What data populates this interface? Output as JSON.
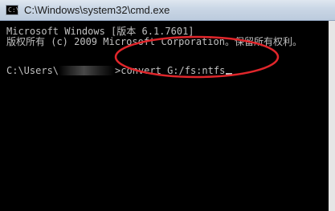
{
  "window": {
    "title": "C:\\Windows\\system32\\cmd.exe",
    "icon": "console-icon",
    "icon_glyph": "C:\\"
  },
  "console": {
    "line1": "Microsoft Windows [版本 6.1.7601]",
    "line2": "版权所有 (c) 2009 Microsoft Corporation。保留所有权利。",
    "prompt_prefix": "C:\\Users\\",
    "prompt_suffix": ">",
    "command": "convert G:/fs:ntfs"
  },
  "annotation": {
    "type": "red-ellipse",
    "color": "#e0262b"
  }
}
